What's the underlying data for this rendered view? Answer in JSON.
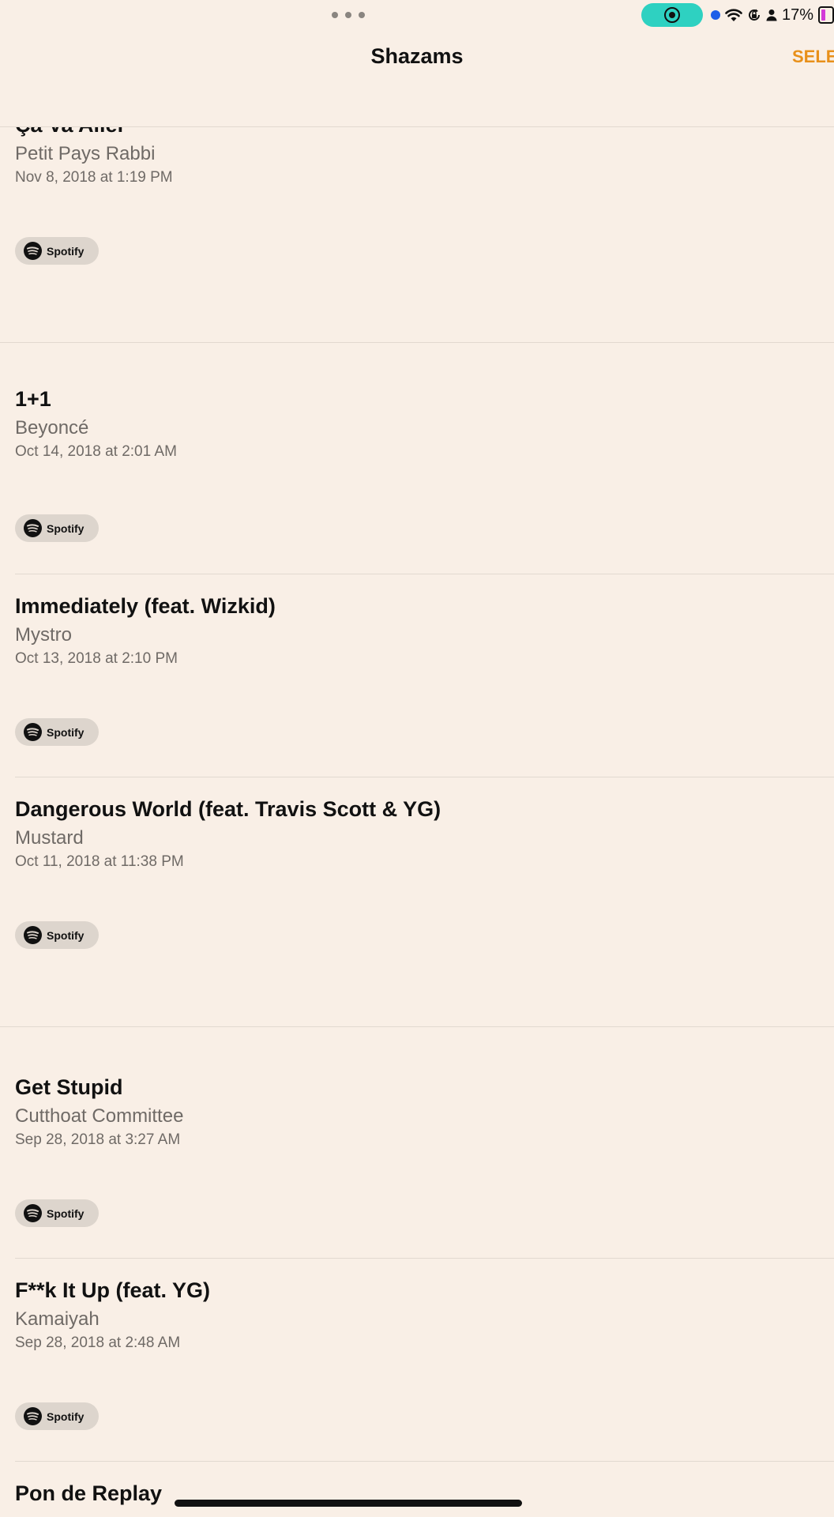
{
  "status_bar": {
    "battery_percent": "17%",
    "icons": [
      "multitasking-dots-icon",
      "screen-record-icon",
      "location-dot-icon",
      "wifi-icon",
      "orientation-lock-icon",
      "person-icon",
      "battery-icon"
    ]
  },
  "header": {
    "title": "Shazams",
    "select_label": "SELE"
  },
  "items": [
    {
      "title": "Ça Va Aller",
      "artist": "Petit Pays Rabbi",
      "date": "Nov 8, 2018 at 1:19 PM",
      "button": "Spotify"
    },
    {
      "title": "1+1",
      "artist": "Beyoncé",
      "date": "Oct 14, 2018 at 2:01 AM",
      "button": "Spotify"
    },
    {
      "title": "Immediately (feat. Wizkid)",
      "artist": "Mystro",
      "date": "Oct 13, 2018 at 2:10 PM",
      "button": "Spotify"
    },
    {
      "title": "Dangerous World (feat. Travis Scott & YG)",
      "artist": "Mustard",
      "date": "Oct 11, 2018 at 11:38 PM",
      "button": "Spotify"
    },
    {
      "title": "Get Stupid",
      "artist": "Cutthoat Committee",
      "date": "Sep 28, 2018 at 3:27 AM",
      "button": "Spotify"
    },
    {
      "title": "F**k It Up (feat. YG)",
      "artist": "Kamaiyah",
      "date": "Sep 28, 2018 at 2:48 AM",
      "button": "Spotify"
    },
    {
      "title": "Pon de Replay",
      "artist": "",
      "date": "",
      "button": ""
    }
  ],
  "colors": {
    "background": "#f9efe6",
    "accent": "#e8901a",
    "secondary_text": "#6f6a66",
    "record_pill": "#2ed1c1"
  }
}
